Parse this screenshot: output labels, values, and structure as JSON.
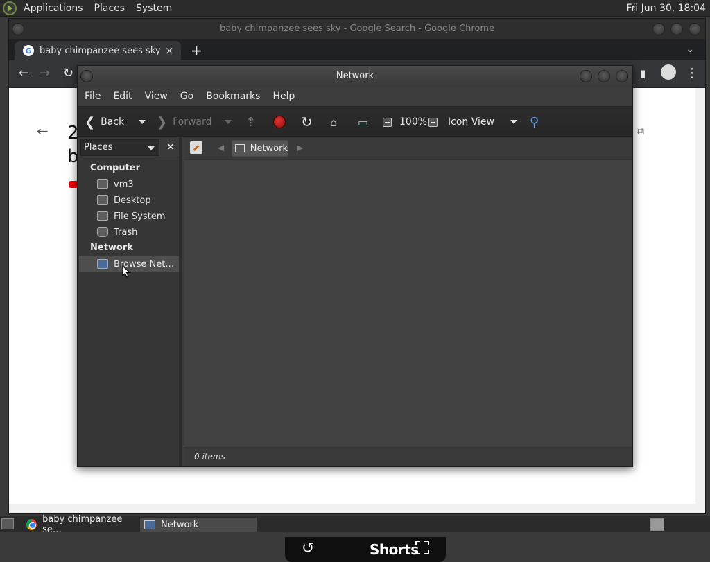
{
  "top_panel": {
    "menus": [
      "Applications",
      "Places",
      "System"
    ],
    "clock": "Fri Jun 30, 18:04"
  },
  "chrome": {
    "window_title": "baby chimpanzee sees sky - Google Search - Google Chrome",
    "tab_title": "baby chimpanzee sees sky - Google Search",
    "tab_close": "×",
    "new_tab": "+",
    "page_title_partial_1": "2",
    "page_title_partial_2": "b",
    "shorts": {
      "label": "Shorts"
    }
  },
  "network_window": {
    "title": "Network",
    "menus": [
      "File",
      "Edit",
      "View",
      "Go",
      "Bookmarks",
      "Help"
    ],
    "toolbar": {
      "back": "Back",
      "forward": "Forward",
      "zoom": "100%",
      "view_mode": "Icon View"
    },
    "sidebar": {
      "selector": "Places",
      "close": "✕",
      "section_computer": "Computer",
      "computer_items": [
        "vm3",
        "Desktop",
        "File System",
        "Trash"
      ],
      "section_network": "Network",
      "network_items": [
        "Browse Net…"
      ]
    },
    "location": {
      "crumb": "Network"
    },
    "status": "0 items"
  },
  "bottom_panel": {
    "tasks": [
      "baby chimpanzee se…",
      "Network"
    ]
  },
  "colors": {
    "panel": "#2b2b2b",
    "window_bg": "#3c3c3c",
    "stop_red": "#c62828",
    "youtube_red": "#e00000"
  }
}
